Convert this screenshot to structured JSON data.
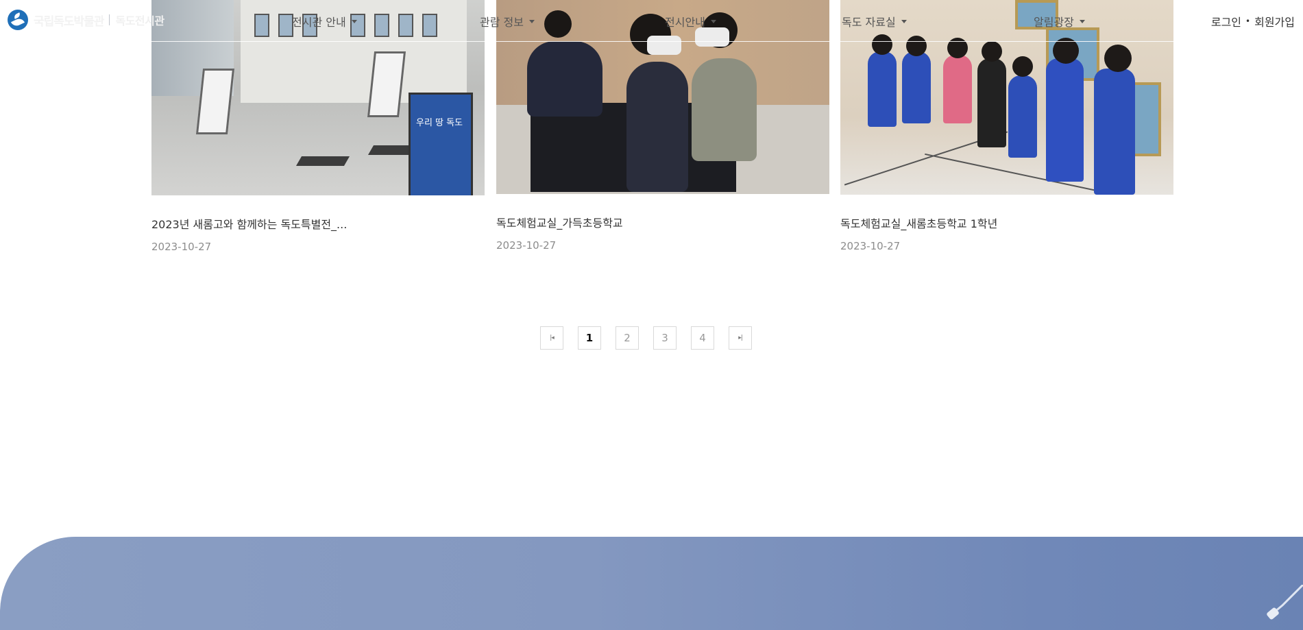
{
  "header": {
    "logo_org": "국립독도박물관",
    "logo_sub": "독도전시관",
    "nav": [
      {
        "label": "전시관 안내",
        "has_dropdown": true
      },
      {
        "label": "관람 정보",
        "has_dropdown": true
      },
      {
        "label": "전시안내",
        "has_dropdown": true
      },
      {
        "label": "독도 자료실",
        "has_dropdown": true
      },
      {
        "label": "알림광장",
        "has_dropdown": true
      }
    ],
    "login_label": "로그인",
    "auth_separator": "•",
    "signup_label": "회원가입"
  },
  "cards": [
    {
      "title": "2023년 새롬고와 함께하는 독도특별전_...",
      "date": "2023-10-27",
      "image": "exhibition-hall-photo"
    },
    {
      "title": "독도체험교실_가득초등학교",
      "date": "2023-10-27",
      "image": "vr-experience-photo"
    },
    {
      "title": "독도체험교실_새롬초등학교 1학년",
      "date": "2023-10-27",
      "image": "students-gallery-photo"
    }
  ],
  "photo1_banner_text": "우리 땅 독도",
  "pagination": {
    "first_icon": "first-page-icon",
    "last_icon": "last-page-icon",
    "pages": [
      "1",
      "2",
      "3",
      "4"
    ],
    "current": "1"
  },
  "colors": {
    "accent": "#1f6fb8",
    "footer_gradient_start": "#8a9ec3",
    "footer_gradient_end": "#6a83b4",
    "date_text": "#8c8c8c"
  }
}
